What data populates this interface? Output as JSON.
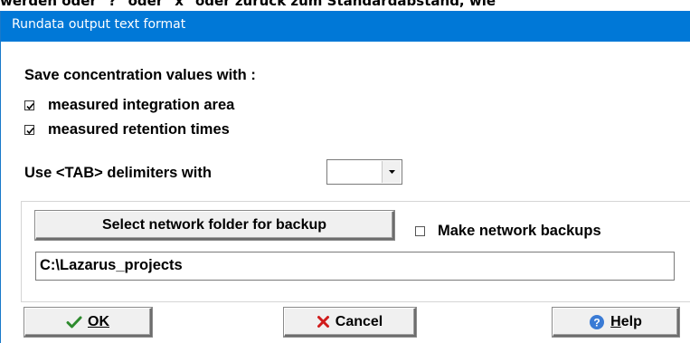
{
  "background_text": "werden oder \"?\" oder \"x\" oder zurück zum Standardabstand, wie",
  "window": {
    "title": "Rundata output text format"
  },
  "concentration": {
    "heading": "Save concentration values with :",
    "option_area_label": "measured integration area",
    "option_area_checked": true,
    "option_retention_label": "measured retention times",
    "option_retention_checked": true
  },
  "delimiters": {
    "label": "Use <TAB> delimiters with",
    "selected": ""
  },
  "backup": {
    "select_folder_label": "Select network folder for backup",
    "make_backups_label": "Make network backups",
    "make_backups_checked": false,
    "folder_path": "C:\\Lazarus_projects"
  },
  "buttons": {
    "ok_label": "OK",
    "cancel_label": "Cancel",
    "help_label": "Help"
  },
  "icons": {
    "ok": "check-icon",
    "cancel": "x-icon",
    "help": "question-icon"
  },
  "colors": {
    "titlebar": "#0078d7",
    "ok_icon": "#2e8b2e",
    "cancel_icon": "#d01c1c",
    "help_icon": "#3a7bd5"
  }
}
